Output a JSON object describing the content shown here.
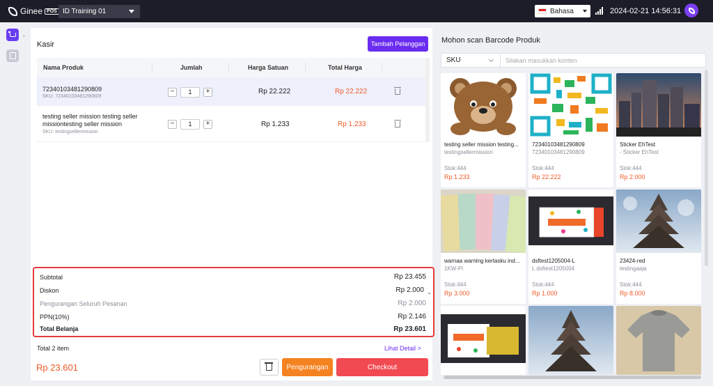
{
  "topbar": {
    "brand": "Ginee",
    "brand_badge": "POS",
    "store": "ID Training 01",
    "language": "Bahasa",
    "datetime": "2024-02-21 14:56:31"
  },
  "cart": {
    "title": "Kasir",
    "add_customer_label": "Tambah Pelanggan",
    "columns": {
      "name": "Nama Produk",
      "qty": "Jumlah",
      "unit_price": "Harga Satuan",
      "total": "Total Harga"
    },
    "items": [
      {
        "name": "72340103481290809",
        "sku": "SKU: 72340103481290809",
        "qty": "1",
        "unit_price": "Rp 22.222",
        "total": "Rp 22.222"
      },
      {
        "name": "testing seller mission testing seller missiontesting seller mission",
        "sku": "SKU: testingsellermission",
        "qty": "1",
        "unit_price": "Rp 1.233",
        "total": "Rp 1.233"
      }
    ],
    "minus": "−",
    "plus": "+"
  },
  "summary": {
    "subtotal_label": "Subtotal",
    "subtotal": "Rp 23.455",
    "discount_label": "Diskon",
    "discount": "Rp 2.000",
    "order_reduction_label": "Pengurangan Seluruh Pesanan",
    "order_reduction": "Rp 2.000",
    "tax_label": "PPN(10%)",
    "tax": "Rp 2.146",
    "total_label": "Total Belanja",
    "total": "Rp 23.601"
  },
  "footer": {
    "total_items": "Total 2 item",
    "detail_link": "Lihat Detail  >",
    "grand_total": "Rp 23.601",
    "reduction_button": "Pengurangan",
    "checkout_button": "Checkout"
  },
  "products_panel": {
    "title": "Mohon scan Barcode Produk",
    "search_type": "SKU",
    "search_placeholder": "Silakan masukkan konten",
    "products": [
      {
        "name": "testing seller mission testing...",
        "sku": "testingsellermission",
        "stock": "Stok:444",
        "price": "Rp 1.233"
      },
      {
        "name": "72340103481290809",
        "sku": "72340103481290809",
        "stock": "Stok:444",
        "price": "Rp 22.222"
      },
      {
        "name": "Sticker EhTest",
        "sku": "- Sticker EhTest",
        "stock": "Stok:444",
        "price": "Rp 2.000"
      },
      {
        "name": "warnaa warning kertasku ind...",
        "sku": "1KW-Pi",
        "stock": "Stok:444",
        "price": "Rp 3.000"
      },
      {
        "name": "dsftest1205004-L",
        "sku": "L dsftest1205004",
        "stock": "Stok:444",
        "price": "Rp 1.000"
      },
      {
        "name": "23424-red",
        "sku": "testingaaja",
        "stock": "Stok:444",
        "price": "Rp 8.000"
      }
    ]
  },
  "colors": {
    "accent": "#6a2cf0",
    "price": "#f05a28",
    "checkout": "#f24a52",
    "reduction": "#f58220",
    "highlight_border": "#e5393a"
  }
}
